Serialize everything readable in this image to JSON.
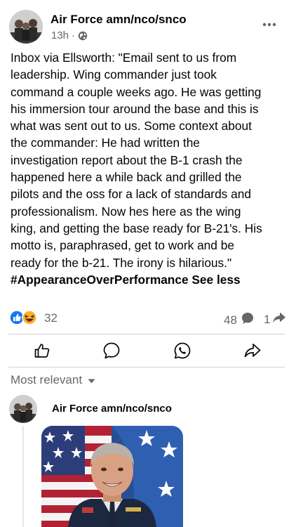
{
  "post": {
    "author": "Air Force amn/nco/snco",
    "time": "13h",
    "separator": "·",
    "icons": {
      "privacy": "globe-icon",
      "menu": "more-options-icon"
    },
    "body_lines": [
      "Inbox via Ellsworth: \"Email sent to us from",
      "leadership. Wing commander just took",
      "command a couple weeks ago. He was getting",
      "his immersion tour around the base and this is",
      "what was sent out to us. Some context about",
      "the commander: He had written the",
      "investigation report about the B-1 crash the",
      "happened here a while back and grilled the",
      "pilots and the oss for a lack of standards and",
      "professionalism. Now hes here as the wing",
      "king, and getting the base ready for B-21's. His",
      "motto is, paraphrased, get to work and be",
      "ready for the b-21. The irony is hilarious.\""
    ],
    "hashtag": "#AppearanceOverPerformance",
    "see_less": "See less"
  },
  "reactions": {
    "icons": [
      "like-reaction-icon",
      "haha-reaction-icon"
    ],
    "count": "32",
    "comments": "48",
    "shares": "1",
    "colors": {
      "like": "#1877f2",
      "haha": "#f7b125",
      "muted": "#65676b"
    }
  },
  "actions": {
    "icons": [
      "like-icon",
      "comment-icon",
      "whatsapp-icon",
      "share-icon"
    ]
  },
  "comments": {
    "sort_label": "Most relevant",
    "items": [
      {
        "author": "Air Force amn/nco/snco",
        "image": "general-portrait-image"
      }
    ]
  }
}
